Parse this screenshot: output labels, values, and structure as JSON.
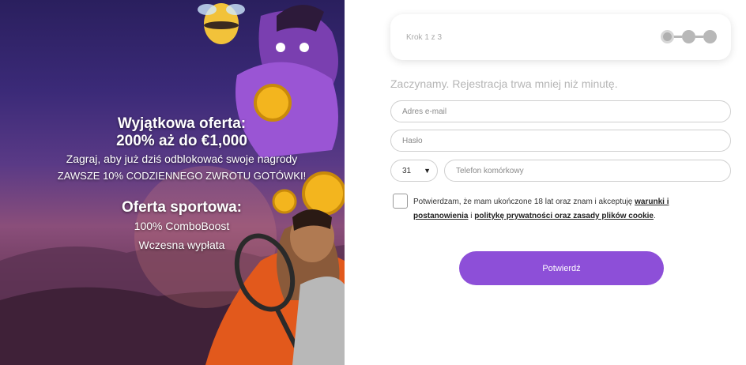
{
  "promo": {
    "title_line1": "Wyjątkowa oferta:",
    "title_line2": "200% aż do €1,000",
    "line1": "Zagraj, aby już dziś odblokować swoje nagrody",
    "line2": "ZAWSZE 10% CODZIENNEGO ZWROTU GOTÓWKI!",
    "sport_title": "Oferta sportowa:",
    "sport_line1": "100% ComboBoost",
    "sport_line2": "Wczesna wypłata",
    "images": [
      "bee-mascot",
      "genie-character",
      "gold-coin",
      "tennis-player"
    ]
  },
  "form": {
    "step_label": "Krok 1 z 3",
    "intro": "Zaczynamy. Rejestracja trwa mniej niż minutę.",
    "email_placeholder": "Adres e-mail",
    "password_placeholder": "Hasło",
    "phone_prefix": "31",
    "phone_placeholder": "Telefon komórkowy",
    "consent_prefix": "Potwierdzam, że mam ukończone 18 lat oraz znam i akceptuję ",
    "consent_link1": "warunki i postanowienia",
    "consent_mid": " i ",
    "consent_link2": "politykę prywatności oraz zasady plików cookie",
    "consent_suffix": ".",
    "submit_label": "Potwierdź"
  },
  "colors": {
    "accent": "#8d4fd8",
    "step_dot": "#b8b8b8"
  }
}
